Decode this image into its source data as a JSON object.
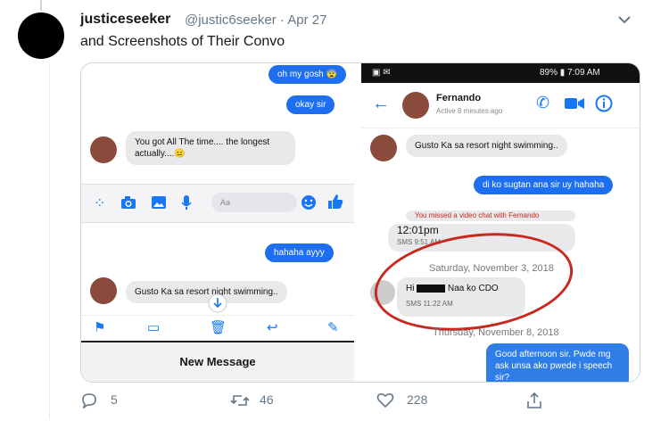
{
  "tweet": {
    "name": "justiceseeker",
    "handle": "@justic6seeker · Apr 27",
    "text": "and Screenshots of Their Convo"
  },
  "left_phone": {
    "msg_top1": "oh my gosh 😨",
    "msg_top2": "okay sir",
    "msg_grey1": "You got All The time.... the longest actually....😐",
    "composer_placeholder": "Aa",
    "msg_blue3": "hahaha ayyy",
    "msg_grey2": "Gusto Ka sa resort night swimming..",
    "new_message": "New Message"
  },
  "right_phone": {
    "status_bar": "89% ▮ 7:09 AM",
    "contact_name": "Fernando",
    "contact_status": "Active 8 minutes ago",
    "msg_grey1": "Gusto Ka sa resort night swimming..",
    "msg_blue1": "di ko sugtan ana sir uy hahaha",
    "msg_missed": "You missed a video chat with Fernando",
    "msg_time": "12:01pm",
    "msg_time_sms": "SMS 9:51 AM",
    "sep1": "Saturday, November 3, 2018",
    "msg_hi_prefix": "Hi",
    "msg_hi_suffix": "Naa ko CDO",
    "msg_hi_sms": "SMS 11:22 AM",
    "sep2": "Thursday, November 8, 2018",
    "msg_blue2": "Good afternoon sir. Pwde mg ask unsa ako pwede i speech sir?"
  },
  "footer": {
    "replies": "5",
    "retweets": "46",
    "likes": "228"
  },
  "colors": {
    "messenger_blue": "#1e6ff0",
    "annotation_red": "#c8281e"
  }
}
